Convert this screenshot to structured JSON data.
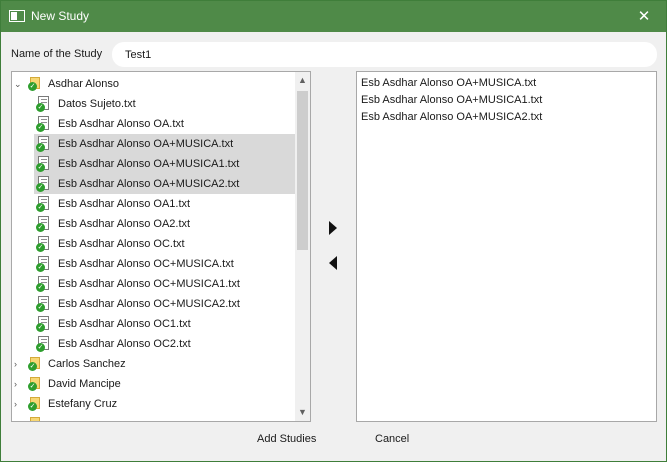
{
  "window": {
    "title": "New Study",
    "close_glyph": "✕",
    "title_icon": "window-app-icon"
  },
  "study_name": {
    "label": "Name of the Study",
    "value": "Test1"
  },
  "tree": {
    "scroll_up": "▲",
    "scroll_down": "▼",
    "rows": [
      {
        "label": "Asdhar Alonso",
        "kind": "folder",
        "level": 0,
        "expander": "⌄",
        "selected": false
      },
      {
        "label": "Datos Sujeto.txt",
        "kind": "file",
        "level": 1,
        "selected": false
      },
      {
        "label": "Esb Asdhar Alonso OA.txt",
        "kind": "file",
        "level": 1,
        "selected": false
      },
      {
        "label": "Esb Asdhar Alonso OA+MUSICA.txt",
        "kind": "file",
        "level": 1,
        "selected": true
      },
      {
        "label": "Esb Asdhar Alonso OA+MUSICA1.txt",
        "kind": "file",
        "level": 1,
        "selected": true
      },
      {
        "label": "Esb Asdhar Alonso OA+MUSICA2.txt",
        "kind": "file",
        "level": 1,
        "selected": true
      },
      {
        "label": "Esb Asdhar Alonso OA1.txt",
        "kind": "file",
        "level": 1,
        "selected": false
      },
      {
        "label": "Esb Asdhar Alonso OA2.txt",
        "kind": "file",
        "level": 1,
        "selected": false
      },
      {
        "label": "Esb Asdhar Alonso OC.txt",
        "kind": "file",
        "level": 1,
        "selected": false
      },
      {
        "label": "Esb Asdhar Alonso OC+MUSICA.txt",
        "kind": "file",
        "level": 1,
        "selected": false
      },
      {
        "label": "Esb Asdhar Alonso OC+MUSICA1.txt",
        "kind": "file",
        "level": 1,
        "selected": false
      },
      {
        "label": "Esb Asdhar Alonso OC+MUSICA2.txt",
        "kind": "file",
        "level": 1,
        "selected": false
      },
      {
        "label": "Esb Asdhar Alonso OC1.txt",
        "kind": "file",
        "level": 1,
        "selected": false
      },
      {
        "label": "Esb Asdhar Alonso OC2.txt",
        "kind": "file",
        "level": 1,
        "selected": false
      },
      {
        "label": "Carlos Sanchez",
        "kind": "folder",
        "level": 0,
        "expander": "›",
        "selected": false
      },
      {
        "label": "David Mancipe",
        "kind": "folder",
        "level": 0,
        "expander": "›",
        "selected": false
      },
      {
        "label": "Estefany Cruz",
        "kind": "folder",
        "level": 0,
        "expander": "›",
        "selected": false
      },
      {
        "label": "",
        "kind": "folder",
        "level": 0,
        "expander": "›",
        "selected": false
      }
    ]
  },
  "selected_studies": [
    "Esb Asdhar Alonso OA+MUSICA.txt",
    "Esb Asdhar Alonso OA+MUSICA1.txt",
    "Esb Asdhar Alonso OA+MUSICA2.txt"
  ],
  "buttons": {
    "add": "Add Studies",
    "cancel": "Cancel",
    "move_right": "arrow-right-icon",
    "move_left": "arrow-left-icon"
  },
  "colors": {
    "titlebar": "#4f8a48",
    "selection": "#d9d9d9",
    "check": "#2e9e2e",
    "folder": "#f7d774"
  }
}
